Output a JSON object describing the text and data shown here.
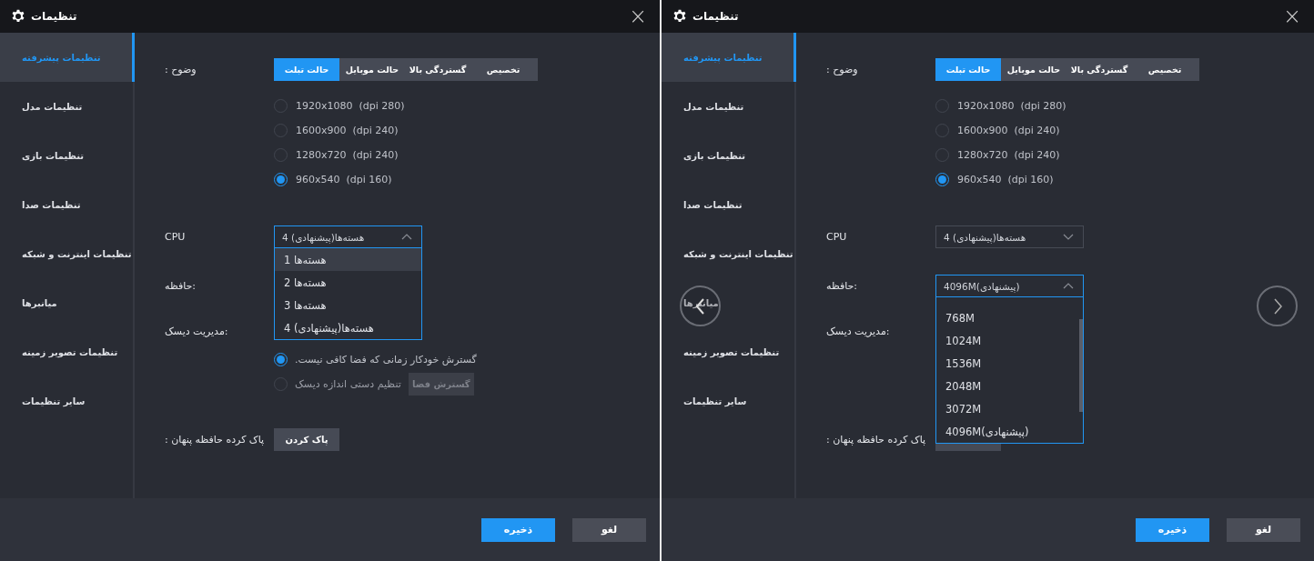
{
  "panels": [
    {
      "title": "تنظیمات",
      "close": "×",
      "sidebar": [
        {
          "label": "تنظیمات پیشرفته",
          "selected": true
        },
        {
          "label": "تنظیمات مدل",
          "selected": false
        },
        {
          "label": "تنظیمات بازی",
          "selected": false
        },
        {
          "label": "تنظیمات صدا",
          "selected": false
        },
        {
          "label": "تنظیمات اینترنت و شبکه",
          "selected": false
        },
        {
          "label": "میانبرها",
          "selected": false
        },
        {
          "label": "تنظیمات تصویر زمینه",
          "selected": false
        },
        {
          "label": "سایر تنظیمات",
          "selected": false
        }
      ],
      "resolution": {
        "label": ": وضوح",
        "tabs": [
          {
            "label": "تخصیص",
            "selected": false
          },
          {
            "label": "گستردگی بالا",
            "selected": false
          },
          {
            "label": "حالت موبایل",
            "selected": false
          },
          {
            "label": "حالت تبلت",
            "selected": true
          }
        ],
        "options": [
          {
            "label": "1920x1080  (dpi 280)",
            "selected": false
          },
          {
            "label": "1600x900  (dpi 240)",
            "selected": false
          },
          {
            "label": "1280x720  (dpi 240)",
            "selected": false
          },
          {
            "label": "960x540  (dpi 160)",
            "selected": true
          }
        ]
      },
      "cpu": {
        "label": "CPU",
        "value": "4 هسته‌ها(پیشنهادی)",
        "expanded": false
      },
      "memory": {
        "label": "حافظه:",
        "value": "4096M(پیشنهادی)",
        "expanded": true,
        "options": [
          {
            "label": "768M",
            "highlighted": false
          },
          {
            "label": "1024M",
            "highlighted": false
          },
          {
            "label": "1536M",
            "highlighted": false
          },
          {
            "label": "2048M",
            "highlighted": false
          },
          {
            "label": "3072M",
            "highlighted": false
          },
          {
            "label": "4096M(پیشنهادی)",
            "highlighted": false
          }
        ]
      },
      "disk": {
        "label": "مدیریت دیسک:"
      },
      "cache": {
        "label": ": پاک کرده حافظه پنهان"
      },
      "footer": {
        "save": "ذخیره",
        "cancel": "لغو"
      },
      "carousel": true
    },
    {
      "title": "تنظیمات",
      "close": "×",
      "sidebar": [
        {
          "label": "تنظیمات پیشرفته",
          "selected": true
        },
        {
          "label": "تنظیمات مدل",
          "selected": false
        },
        {
          "label": "تنظیمات بازی",
          "selected": false
        },
        {
          "label": "تنظیمات صدا",
          "selected": false
        },
        {
          "label": "تنظیمات اینترنت و شبکه",
          "selected": false
        },
        {
          "label": "میانبرها",
          "selected": false
        },
        {
          "label": "تنظیمات تصویر زمینه",
          "selected": false
        },
        {
          "label": "سایر تنظیمات",
          "selected": false
        }
      ],
      "resolution": {
        "label": ": وضوح",
        "tabs": [
          {
            "label": "تخصیص",
            "selected": false
          },
          {
            "label": "گستردگی بالا",
            "selected": false
          },
          {
            "label": "حالت موبایل",
            "selected": false
          },
          {
            "label": "حالت تبلت",
            "selected": true
          }
        ],
        "options": [
          {
            "label": "1920x1080  (dpi 280)",
            "selected": false
          },
          {
            "label": "1600x900  (dpi 240)",
            "selected": false
          },
          {
            "label": "1280x720  (dpi 240)",
            "selected": false
          },
          {
            "label": "960x540  (dpi 160)",
            "selected": true
          }
        ]
      },
      "cpu": {
        "label": "CPU",
        "value": "4 هسته‌ها(پیشنهادی)",
        "expanded": true,
        "options": [
          {
            "label": "1 هسته‌ها",
            "highlighted": true
          },
          {
            "label": "2 هسته‌ها",
            "highlighted": false
          },
          {
            "label": "3 هسته‌ها",
            "highlighted": false
          },
          {
            "label": "4 هسته‌ها(پیشنهادی)",
            "highlighted": false
          }
        ]
      },
      "memory": {
        "label": "حافظه:"
      },
      "disk": {
        "label": "مدیریت دیسک:",
        "options": [
          {
            "label": ".گسترش خودکار زمانی که فضا کافی نیست",
            "selected": true
          },
          {
            "label": "تنظیم دستی اندازه دیسک",
            "selected": false
          }
        ],
        "expand_button": {
          "label": "گسترش فضا",
          "disabled": true
        }
      },
      "cache": {
        "label": ": پاک کرده حافظه پنهان",
        "button": "پاک کردن"
      },
      "footer": {
        "save": "ذخیره",
        "cancel": "لغو"
      }
    }
  ]
}
